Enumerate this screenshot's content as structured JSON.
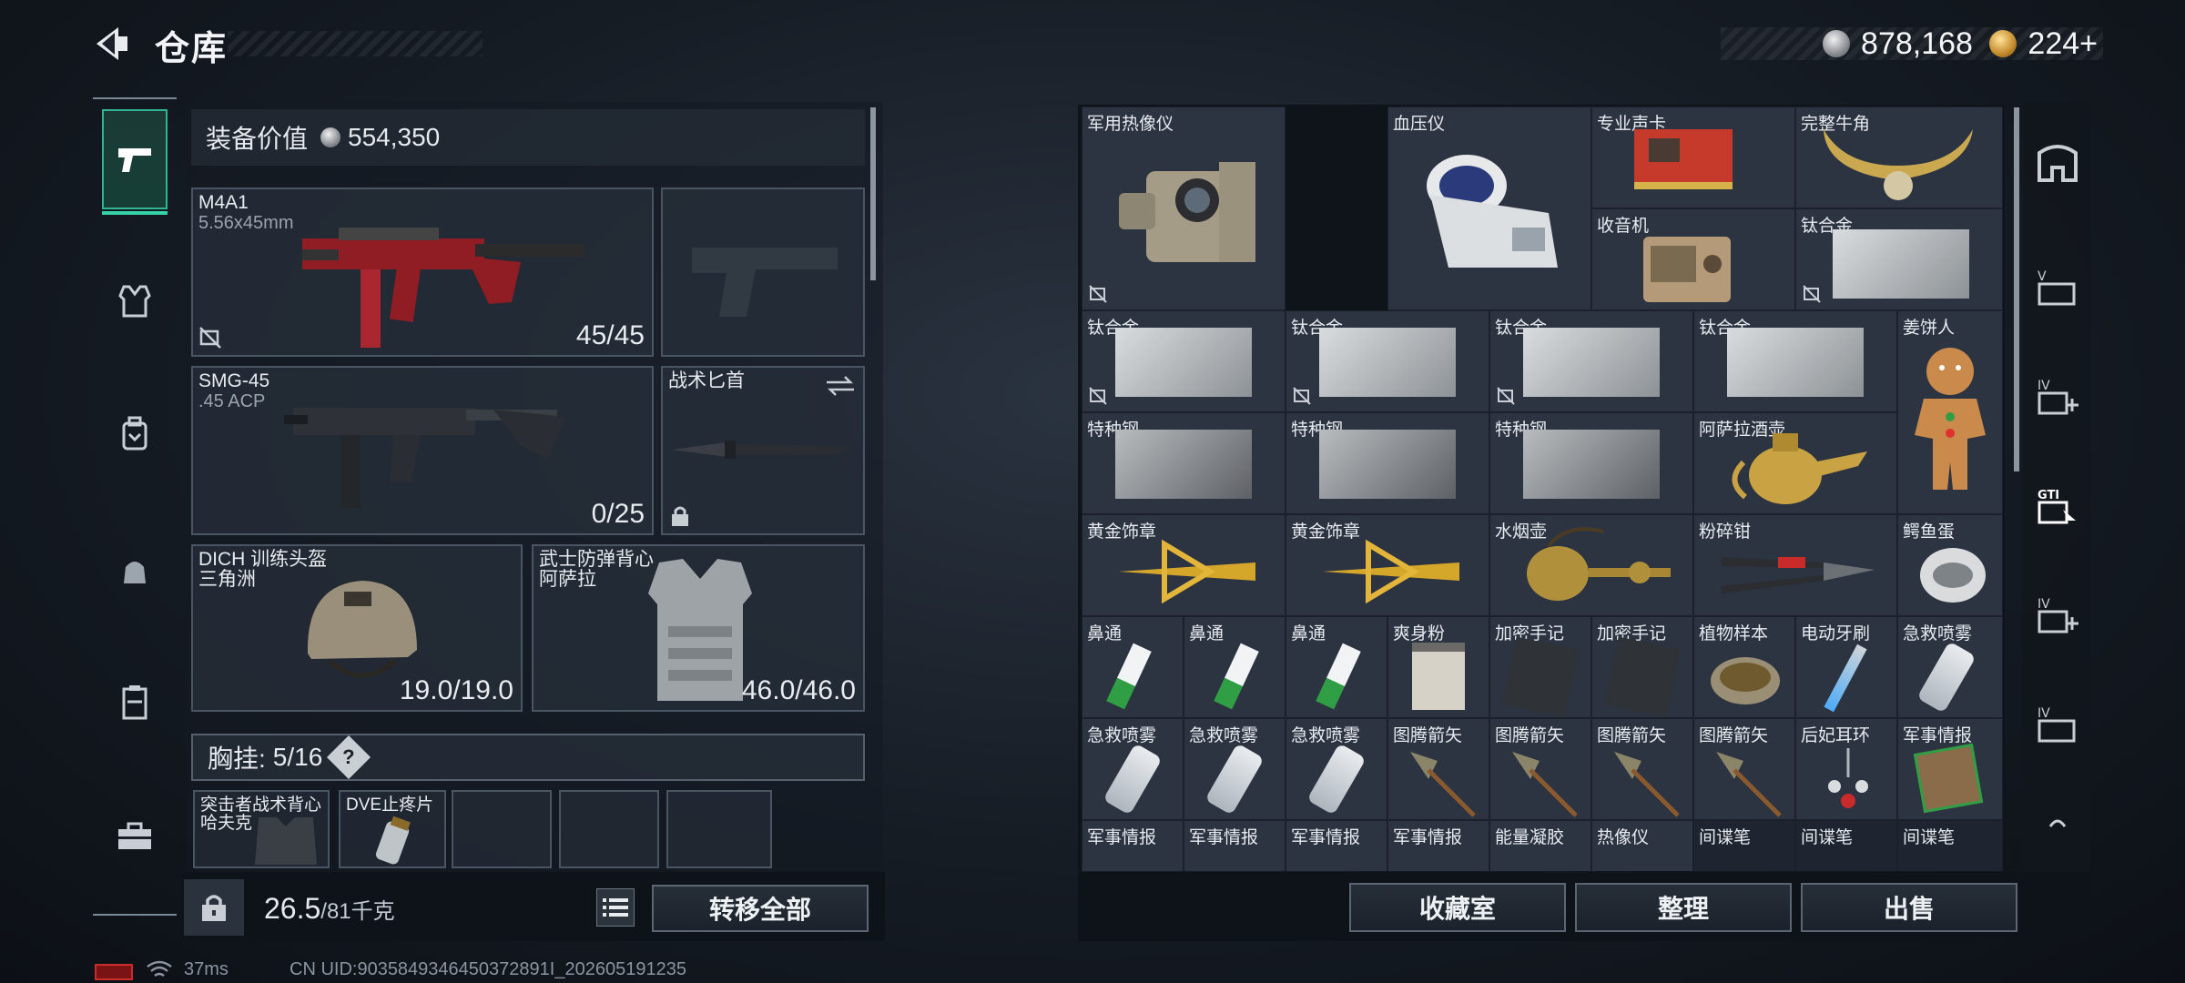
{
  "header": {
    "title": "仓库"
  },
  "currency": {
    "silver": "878,168",
    "gold": "224",
    "gold_plus": "+"
  },
  "nav": {
    "items": [
      "weapon",
      "armor",
      "backpack",
      "pouch",
      "container",
      "toolbox"
    ]
  },
  "equipment": {
    "value_label": "装备价值",
    "value": "554,350",
    "primary": {
      "name": "M4A1",
      "caliber": "5.56x45mm",
      "ammo": "45/45"
    },
    "secondary": {
      "name": "SMG-45",
      "caliber": ".45 ACP",
      "ammo": "0/25"
    },
    "melee": {
      "name": "战术匕首"
    },
    "helmet": {
      "name": "DICH 训练头盔",
      "sub": "三角洲",
      "durability": "19.0/19.0"
    },
    "armor": {
      "name": "武士防弹背心",
      "sub": "阿萨拉",
      "durability": "46.0/46.0"
    },
    "rig": {
      "label": "胸挂:",
      "value": "5/16",
      "help": "?"
    },
    "small_slots": [
      {
        "name": "突击者战术背心",
        "sub": "哈夫克"
      },
      {
        "name": "DVE止疼片",
        "sub": ""
      }
    ],
    "weight": {
      "current": "26.5",
      "max": "/81",
      "unit": "千克"
    },
    "transfer_all": "转移全部"
  },
  "status": {
    "ping": "37ms",
    "uid": "CN UID:9035849346450372891I_202605191235"
  },
  "warehouse": {
    "items": [
      {
        "label": "军用热像仪"
      },
      {
        "label": "血压仪"
      },
      {
        "label": "专业声卡"
      },
      {
        "label": "完整牛角"
      },
      {
        "label": "收音机"
      },
      {
        "label": "钛合金"
      },
      {
        "label": "钛合金"
      },
      {
        "label": "钛合金"
      },
      {
        "label": "钛合金"
      },
      {
        "label": "钛合金"
      },
      {
        "label": "姜饼人"
      },
      {
        "label": "特种钢"
      },
      {
        "label": "特种钢"
      },
      {
        "label": "特种钢"
      },
      {
        "label": "阿萨拉酒壶"
      },
      {
        "label": "黄金饰章"
      },
      {
        "label": "黄金饰章"
      },
      {
        "label": "水烟壶"
      },
      {
        "label": "粉碎钳"
      },
      {
        "label": "鳄鱼蛋"
      },
      {
        "label": "鼻通"
      },
      {
        "label": "鼻通"
      },
      {
        "label": "鼻通"
      },
      {
        "label": "爽身粉"
      },
      {
        "label": "加密手记"
      },
      {
        "label": "加密手记"
      },
      {
        "label": "植物样本"
      },
      {
        "label": "电动牙刷"
      },
      {
        "label": "急救喷雾"
      },
      {
        "label": "急救喷雾"
      },
      {
        "label": "急救喷雾"
      },
      {
        "label": "急救喷雾"
      },
      {
        "label": "图腾箭矢"
      },
      {
        "label": "图腾箭矢"
      },
      {
        "label": "图腾箭矢"
      },
      {
        "label": "图腾箭矢"
      },
      {
        "label": "后妃耳环"
      },
      {
        "label": "军事情报"
      },
      {
        "label": "军事情报"
      },
      {
        "label": "军事情报"
      },
      {
        "label": "军事情报"
      },
      {
        "label": "军事情报"
      },
      {
        "label": "能量凝胶"
      },
      {
        "label": "热像仪"
      },
      {
        "label": "间谍笔"
      },
      {
        "label": "间谍笔"
      },
      {
        "label": "间谍笔"
      }
    ]
  },
  "actions": {
    "collection": "收藏室",
    "sort": "整理",
    "sell": "出售"
  },
  "rail": {
    "items": [
      "safe-box-icon",
      "slot-v-icon",
      "slot-iv-add-icon",
      "gti-icon",
      "slot-iv-add-icon-2",
      "slot-iv-icon",
      "arrow-up-icon"
    ]
  }
}
